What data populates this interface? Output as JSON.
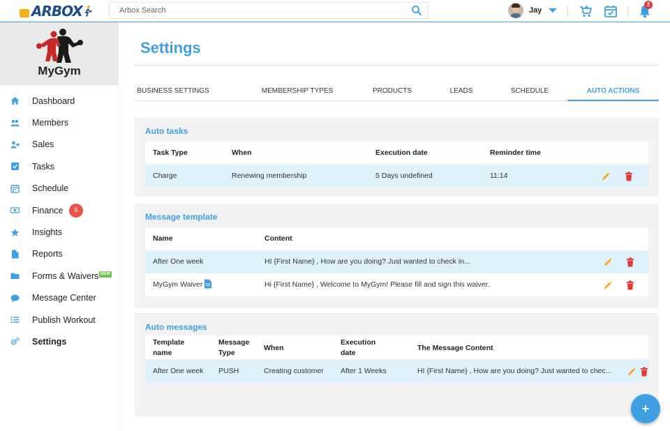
{
  "topbar": {
    "logo_text": "ARBOX",
    "search_placeholder": "Arbox Search",
    "user_name": "Jay",
    "notifications_count": "2",
    "icons": [
      "search-icon",
      "shopping-cart-icon",
      "calendar-check-icon",
      "bell-icon"
    ]
  },
  "sidebar": {
    "gym_name": "MyGym",
    "items": [
      {
        "label": "Dashboard",
        "icon": "home-icon"
      },
      {
        "label": "Members",
        "icon": "users-icon"
      },
      {
        "label": "Sales",
        "icon": "add-user-icon"
      },
      {
        "label": "Tasks",
        "icon": "checkbox-icon"
      },
      {
        "label": "Schedule",
        "icon": "calendar-icon"
      },
      {
        "label": "Finance",
        "icon": "money-icon",
        "badge": "6"
      },
      {
        "label": "Insights",
        "icon": "star-icon"
      },
      {
        "label": "Reports",
        "icon": "file-icon"
      },
      {
        "label": "Forms & Waivers",
        "icon": "folder-icon",
        "badge": "NEW"
      },
      {
        "label": "Message Center",
        "icon": "chat-icon"
      },
      {
        "label": "Publish Workout",
        "icon": "list-icon"
      },
      {
        "label": "Settings",
        "icon": "gears-icon",
        "active": true
      }
    ]
  },
  "main": {
    "title": "Settings",
    "tabs": [
      {
        "label": "BUSINESS SETTINGS"
      },
      {
        "label": "MEMBERSHIP TYPES"
      },
      {
        "label": "PRODUCTS"
      },
      {
        "label": "LEADS"
      },
      {
        "label": "SCHEDULE"
      },
      {
        "label": "AUTO ACTIONS",
        "active": true
      }
    ],
    "auto_tasks": {
      "title": "Auto tasks",
      "headers": [
        "Task Type",
        "When",
        "Execution date",
        "Reminder time"
      ],
      "rows": [
        {
          "task_type": "Charge",
          "when": "Renewing membership",
          "execution_date": "5 Days undefined",
          "reminder_time": "11:14"
        }
      ]
    },
    "message_template": {
      "title": "Message template",
      "headers": [
        "Name",
        "Content"
      ],
      "rows": [
        {
          "name": "After One week",
          "content": "HI {First Name} , How are you doing? Just wanted to check in..."
        },
        {
          "name": "MyGym Waiver",
          "content": "Hi {First Name} , Welcome to MyGym! Please fill and sign this waiver."
        }
      ]
    },
    "auto_messages": {
      "title": "Auto messages",
      "headers": {
        "template_name_1": "Template",
        "template_name_2": "name",
        "message_type_1": "Message",
        "message_type_2": "Type",
        "when": "When",
        "execution_date_1": "Execution",
        "execution_date_2": "date",
        "content": "The Message Content"
      },
      "rows": [
        {
          "template_name": "After One week",
          "message_type": "PUSH",
          "when": "Creating customer",
          "execution_date": "After 1 Weeks",
          "content": "HI {First Name} , How are you doing? Just wanted to chec..."
        }
      ]
    }
  },
  "fab_label": "+",
  "colors": {
    "accent": "#3ea0e3",
    "highlight_row": "#dff1fa",
    "edit": "#f5a623",
    "delete": "#e53935"
  }
}
